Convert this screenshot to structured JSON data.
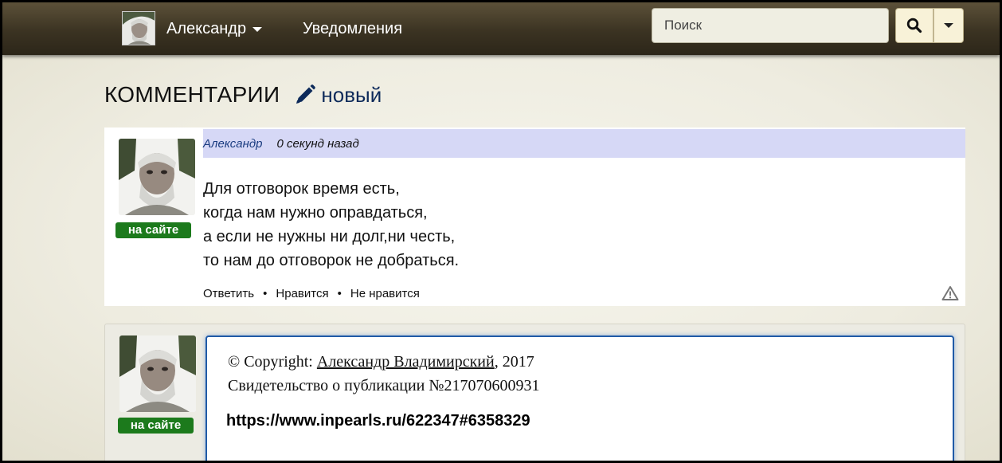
{
  "navbar": {
    "user_name": "Александр",
    "notifications_label": "Уведомления",
    "search_placeholder": "Поиск",
    "search_icon": "search-icon",
    "dropdown_icon": "chevron-down-icon"
  },
  "page": {
    "title": "КОММЕНТАРИИ",
    "new_label": "новый",
    "new_icon": "pencil-icon"
  },
  "comment": {
    "author": "Александр",
    "time": "0 секунд назад",
    "status_badge": "на сайте",
    "lines": [
      "Для отговорок время есть,",
      "когда нам нужно оправдаться,",
      "а если не нужны ни долг,ни честь,",
      "то нам до отговорок не добраться."
    ],
    "actions": {
      "reply": "Ответить",
      "like": "Нравится",
      "dislike": "Не нравится"
    },
    "report_icon": "warning-icon"
  },
  "reply": {
    "status_badge": "на сайте",
    "copyright_prefix": "© Copyright: ",
    "copyright_author": "Александр Владимирский",
    "copyright_suffix": ", 2017",
    "certificate": "Свидетельство о публикации №217070600931",
    "url": "https://www.inpearls.ru/622347#6358329"
  },
  "colors": {
    "navbar": "#3b3322",
    "header_bg": "#d6d8f6",
    "online_badge": "#1c7a1c",
    "editor_border": "#1f5aa6",
    "link": "#1a3c80"
  }
}
